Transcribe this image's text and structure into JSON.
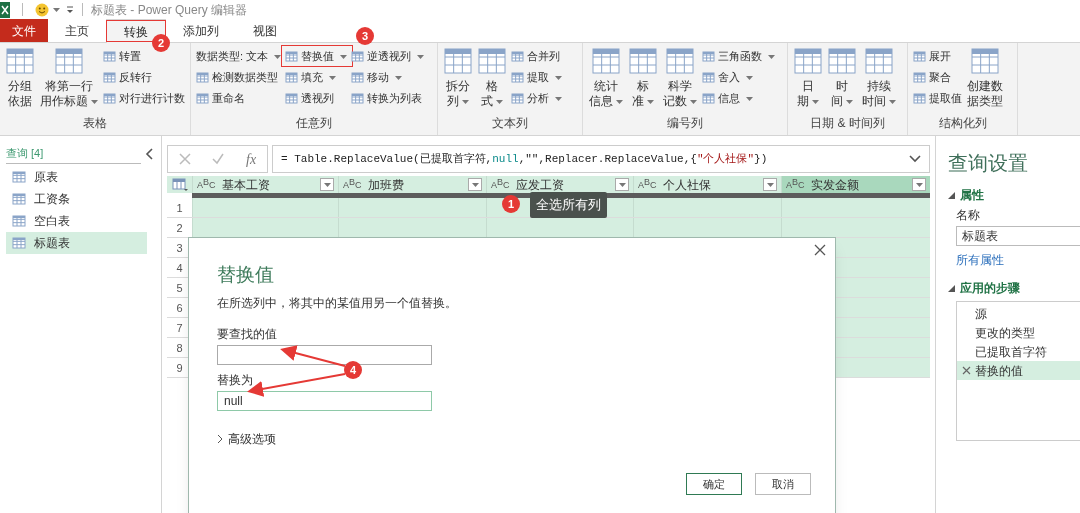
{
  "title_bar": {
    "title": "标题表 - Power Query 编辑器"
  },
  "tabs": [
    {
      "label": "文件",
      "kind": "file",
      "selected": false
    },
    {
      "label": "主页",
      "kind": "tab",
      "selected": false
    },
    {
      "label": "转换",
      "kind": "tab",
      "selected": true
    },
    {
      "label": "添加列",
      "kind": "tab",
      "selected": false
    },
    {
      "label": "视图",
      "kind": "tab",
      "selected": false
    }
  ],
  "ribbon": {
    "groups": [
      {
        "label": "表格",
        "columns": [
          {
            "kind": "large",
            "lines": [
              "分组",
              "依据"
            ],
            "dropdown": false
          },
          {
            "kind": "large",
            "lines": [
              "将第一行",
              "用作标题"
            ],
            "dropdown": true
          },
          {
            "kind": "stack",
            "items": [
              {
                "kind": "small",
                "label": "转置",
                "dropdown": false
              },
              {
                "kind": "small",
                "label": "反转行",
                "dropdown": false
              },
              {
                "kind": "small",
                "label": "对行进行计数",
                "dropdown": false
              }
            ]
          }
        ]
      },
      {
        "label": "任意列",
        "columns": [
          {
            "kind": "stack",
            "items": [
              {
                "kind": "text",
                "label": "数据类型: 文本",
                "dropdown": true
              },
              {
                "kind": "small",
                "label": "检测数据类型",
                "dropdown": false
              },
              {
                "kind": "small",
                "label": "重命名",
                "dropdown": false
              }
            ]
          },
          {
            "kind": "stack",
            "items": [
              {
                "kind": "small",
                "label": "替换值",
                "dropdown": true
              },
              {
                "kind": "small",
                "label": "填充",
                "dropdown": true
              },
              {
                "kind": "small",
                "label": "透视列",
                "dropdown": false
              }
            ]
          },
          {
            "kind": "stack",
            "items": [
              {
                "kind": "small",
                "label": "逆透视列",
                "dropdown": true
              },
              {
                "kind": "small",
                "label": "移动",
                "dropdown": true
              },
              {
                "kind": "small",
                "label": "转换为列表",
                "dropdown": false
              }
            ]
          }
        ]
      },
      {
        "label": "文本列",
        "columns": [
          {
            "kind": "large",
            "lines": [
              "拆分",
              "列"
            ],
            "dropdown": true
          },
          {
            "kind": "large",
            "lines": [
              "格",
              "式"
            ],
            "dropdown": true
          },
          {
            "kind": "stack",
            "items": [
              {
                "kind": "small",
                "label": "合并列",
                "dropdown": false
              },
              {
                "kind": "small",
                "label": "提取",
                "dropdown": true
              },
              {
                "kind": "small",
                "label": "分析",
                "dropdown": true
              }
            ]
          }
        ]
      },
      {
        "label": "编号列",
        "columns": [
          {
            "kind": "large",
            "lines": [
              "统计",
              "信息"
            ],
            "dropdown": true
          },
          {
            "kind": "large",
            "lines": [
              "标",
              "准"
            ],
            "dropdown": true
          },
          {
            "kind": "large",
            "lines": [
              "科学",
              "记数"
            ],
            "dropdown": true
          },
          {
            "kind": "stack",
            "items": [
              {
                "kind": "small",
                "label": "三角函数",
                "dropdown": true
              },
              {
                "kind": "small",
                "label": "舍入",
                "dropdown": true
              },
              {
                "kind": "small",
                "label": "信息",
                "dropdown": true
              }
            ]
          }
        ]
      },
      {
        "label": "日期 & 时间列",
        "columns": [
          {
            "kind": "large",
            "lines": [
              "日",
              "期"
            ],
            "dropdown": true
          },
          {
            "kind": "large",
            "lines": [
              "时",
              "间"
            ],
            "dropdown": true
          },
          {
            "kind": "large",
            "lines": [
              "持续",
              "时间"
            ],
            "dropdown": true
          }
        ]
      },
      {
        "label": "结构化列",
        "columns": [
          {
            "kind": "stack",
            "items": [
              {
                "kind": "small",
                "label": "展开",
                "dropdown": false
              },
              {
                "kind": "small",
                "label": "聚合",
                "dropdown": false
              },
              {
                "kind": "small",
                "label": "提取值",
                "dropdown": false
              }
            ]
          },
          {
            "kind": "large",
            "lines": [
              "创建数",
              "据类型"
            ],
            "dropdown": false
          }
        ]
      }
    ]
  },
  "queries": {
    "header": "查询 [4]",
    "items": [
      {
        "label": "原表",
        "selected": false
      },
      {
        "label": "工资条",
        "selected": false
      },
      {
        "label": "空白表",
        "selected": false
      },
      {
        "label": "标题表",
        "selected": true
      }
    ]
  },
  "formula_bar": {
    "fx": "fx",
    "segments": [
      {
        "kind": "plain",
        "text": "= Table.ReplaceValue(已提取首字符,"
      },
      {
        "kind": "keyword",
        "text": "null"
      },
      {
        "kind": "plain",
        "text": ",\"\",Replacer.ReplaceValue,{"
      },
      {
        "kind": "string",
        "text": "\"个人社保\""
      },
      {
        "kind": "plain",
        "text": "})"
      }
    ]
  },
  "table": {
    "columns": [
      {
        "type": "ABC",
        "name": "基本工资",
        "highlighted": false
      },
      {
        "type": "ABC",
        "name": "加班费",
        "highlighted": false
      },
      {
        "type": "ABC",
        "name": "应发工资",
        "highlighted": false
      },
      {
        "type": "ABC",
        "name": "个人社保",
        "highlighted": false
      },
      {
        "type": "ABC",
        "name": "实发金额",
        "highlighted": true
      }
    ],
    "row_numbers": [
      "1",
      "2",
      "3",
      "4",
      "5",
      "6",
      "7",
      "8",
      "9"
    ]
  },
  "dialog": {
    "title": "替换值",
    "description": "在所选列中，将其中的某值用另一个值替换。",
    "fields": [
      {
        "label": "要查找的值",
        "focused": false
      },
      {
        "label": "替换为",
        "value": "null",
        "focused": true
      }
    ],
    "advanced": "高级选项",
    "buttons": [
      {
        "label": "确定",
        "kind": "primary"
      },
      {
        "label": "取消",
        "kind": "secondary"
      }
    ]
  },
  "settings": {
    "title": "查询设置",
    "properties_heading": "属性",
    "name_label": "名称",
    "name_value": "标题表",
    "all_properties": "所有属性",
    "steps_heading": "应用的步骤",
    "steps": [
      {
        "label": "源",
        "selected": false
      },
      {
        "label": "更改的类型",
        "selected": false
      },
      {
        "label": "已提取首字符",
        "selected": false
      },
      {
        "label": "替换的值",
        "selected": true
      }
    ]
  },
  "annotations": {
    "badges": [
      "1",
      "2",
      "3",
      "4"
    ],
    "tooltip": "全选所有列"
  }
}
